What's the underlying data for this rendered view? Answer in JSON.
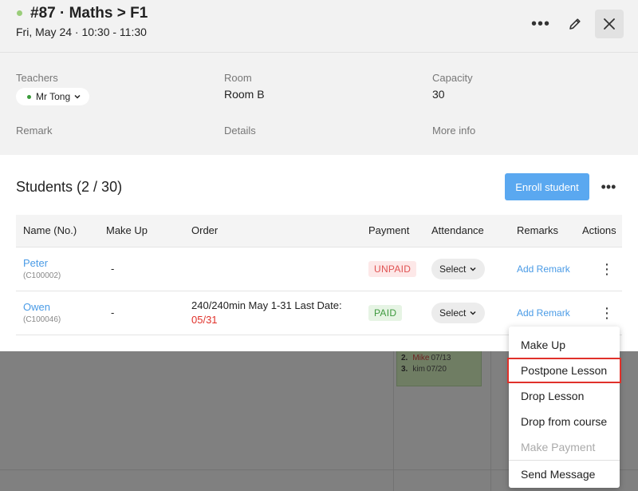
{
  "header": {
    "title": "#87 · Maths > F1",
    "subtitle": "Fri, May 24 · 10:30 - 11:30",
    "status_color": "#9acd7a"
  },
  "info": {
    "teachers_label": "Teachers",
    "teacher_name": "Mr Tong",
    "room_label": "Room",
    "room_value": "Room B",
    "capacity_label": "Capacity",
    "capacity_value": "30",
    "remark_label": "Remark",
    "details_label": "Details",
    "more_info_label": "More info"
  },
  "students": {
    "title": "Students (2 / 30)",
    "enroll_label": "Enroll student",
    "columns": [
      "Name (No.)",
      "Make Up",
      "Order",
      "Payment",
      "Attendance",
      "Remarks",
      "Actions"
    ],
    "rows": [
      {
        "name": "Peter",
        "no": "(C100002)",
        "make_up": "-",
        "order_text": "",
        "order_date": "",
        "payment": "UNPAID",
        "attendance": "Select",
        "remark": "Add Remark"
      },
      {
        "name": "Owen",
        "no": "(C100046)",
        "make_up": "-",
        "order_text": "240/240min May 1-31 Last Date:",
        "order_date": "05/31",
        "payment": "PAID",
        "attendance": "Select",
        "remark": "Add Remark"
      }
    ]
  },
  "menu": {
    "items": [
      "Make Up",
      "Postpone Lesson",
      "Drop Lesson",
      "Drop from course",
      "Make Payment",
      "Send Message"
    ]
  },
  "background_event": {
    "rows": [
      {
        "num": "2.",
        "name": "Mike",
        "date": "07/13"
      },
      {
        "num": "3.",
        "name": "kim",
        "date": "07/20"
      }
    ]
  }
}
